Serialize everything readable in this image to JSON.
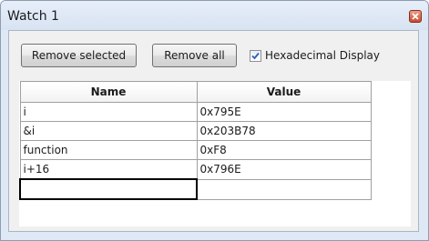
{
  "window": {
    "title": "Watch 1"
  },
  "toolbar": {
    "remove_selected_label": "Remove selected",
    "remove_all_label": "Remove all",
    "hex_display_label": "Hexadecimal Display",
    "hex_display_checked": true
  },
  "grid": {
    "columns": [
      "Name",
      "Value"
    ],
    "rows": [
      {
        "name": "i",
        "value": "0x795E"
      },
      {
        "name": "&i",
        "value": "0x203B78"
      },
      {
        "name": "function",
        "value": "0xF8"
      },
      {
        "name": "i+16",
        "value": "0x796E"
      }
    ],
    "new_row": {
      "name": "",
      "value": ""
    }
  },
  "icons": {
    "close": "close-icon",
    "check": "checkmark-icon"
  },
  "colors": {
    "title_bar": "#dfe8f5",
    "close_button": "#c84a2c",
    "checkmark": "#2d5fb5",
    "grid_border": "#a0a0a0"
  }
}
